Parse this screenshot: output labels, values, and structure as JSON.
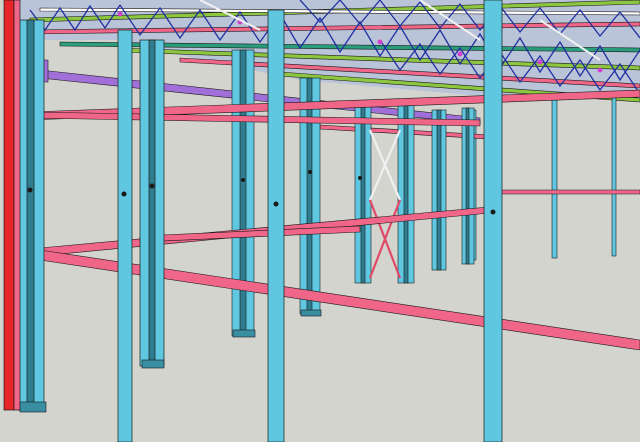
{
  "viewport": {
    "background": "#d4d4ce",
    "layers": [
      {
        "name": "roof-truss-web",
        "color": "#2030a0"
      },
      {
        "name": "roof-truss-chord",
        "color": "#2a9e7a"
      },
      {
        "name": "roof-purlin",
        "color": "#8dc63f"
      },
      {
        "name": "column",
        "color": "#5fc7df"
      },
      {
        "name": "column-batten",
        "color": "#2f7d8f"
      },
      {
        "name": "tie-beam",
        "color": "#f06688"
      },
      {
        "name": "eave-beam",
        "color": "#a070d8"
      },
      {
        "name": "end-frame-column",
        "color": "#e8262a"
      },
      {
        "name": "bracing",
        "color": "#e04a66"
      },
      {
        "name": "outline",
        "color": "#1a1a1a"
      }
    ],
    "icons": [
      "steel-frame-model-icon"
    ]
  }
}
